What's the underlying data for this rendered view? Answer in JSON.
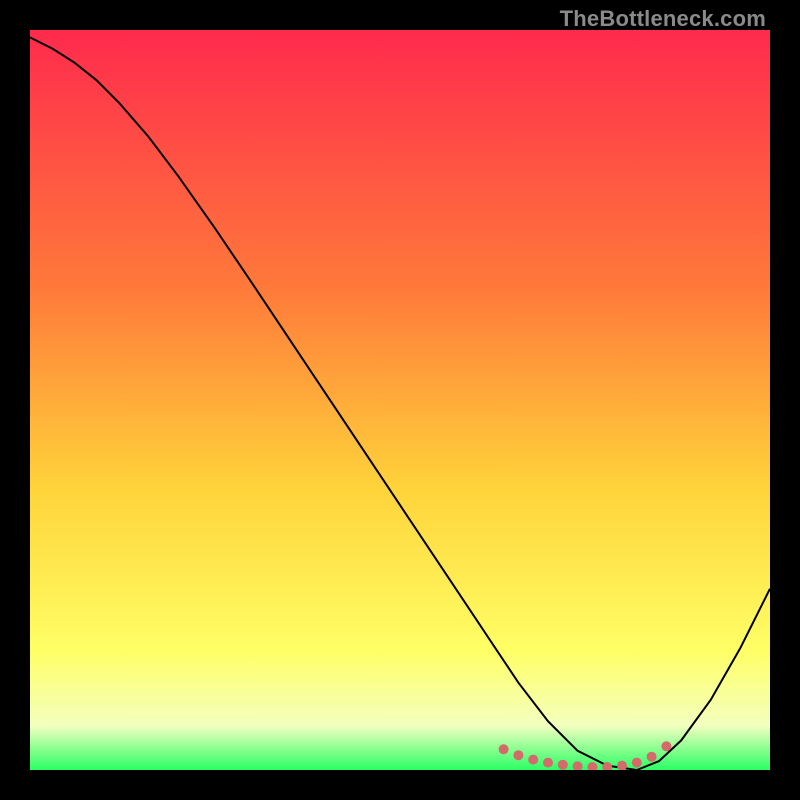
{
  "watermark": "TheBottleneck.com",
  "chart_data": {
    "type": "line",
    "title": "",
    "xlabel": "",
    "ylabel": "",
    "xlim": [
      0,
      100
    ],
    "ylim": [
      0,
      100
    ],
    "grid": false,
    "legend": false,
    "gradient_stops": [
      {
        "offset": 0,
        "color": "#ff2a4d"
      },
      {
        "offset": 35,
        "color": "#ff7a3a"
      },
      {
        "offset": 62,
        "color": "#ffd33a"
      },
      {
        "offset": 84,
        "color": "#ffff66"
      },
      {
        "offset": 94,
        "color": "#f3ffbf"
      },
      {
        "offset": 100,
        "color": "#2bff66"
      }
    ],
    "series": [
      {
        "name": "bottleneck-curve",
        "color": "#000000",
        "width": 2.0,
        "x": [
          0,
          3,
          6,
          9,
          12,
          16,
          20,
          25,
          30,
          35,
          40,
          45,
          50,
          55,
          60,
          63,
          66,
          70,
          74,
          78,
          82,
          85,
          88,
          92,
          96,
          100
        ],
        "y": [
          99,
          97.5,
          95.6,
          93.2,
          90.2,
          85.6,
          80.3,
          73.2,
          65.8,
          58.3,
          50.8,
          43.3,
          35.8,
          28.3,
          20.8,
          16.3,
          11.8,
          6.6,
          2.6,
          0.6,
          0.0,
          1.2,
          4.0,
          9.5,
          16.5,
          24.5
        ]
      },
      {
        "name": "optimal-zone-markers",
        "color": "#d46a6a",
        "type": "scatter",
        "marker_size": 10,
        "x": [
          64,
          66,
          68,
          70,
          72,
          74,
          76,
          78,
          80,
          82,
          84,
          86
        ],
        "y": [
          2.8,
          2.0,
          1.4,
          1.0,
          0.7,
          0.5,
          0.4,
          0.4,
          0.6,
          1.0,
          1.8,
          3.2
        ]
      }
    ],
    "annotations": []
  }
}
